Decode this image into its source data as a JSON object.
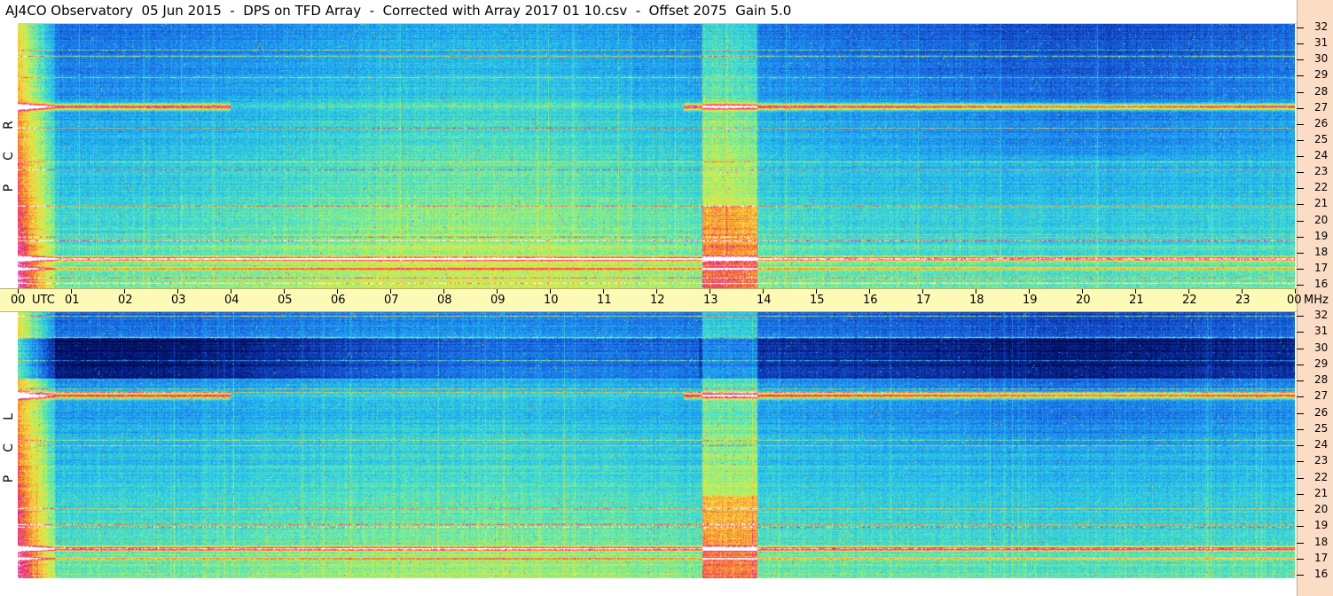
{
  "title": "AJ4CO Observatory  05 Jun 2015  -  DPS on TFD Array  -  Corrected with Array 2017 01 10.csv  -  Offset 2075  Gain 5.0",
  "chart_data": {
    "type": "heatmap",
    "title": "AJ4CO Observatory  05 Jun 2015  -  DPS on TFD Array  -  Corrected with Array 2017 01 10.csv  -  Offset 2075  Gain 5.0",
    "x_axis": {
      "unit_label": "UTC",
      "tick_labels": [
        "00",
        "01",
        "02",
        "03",
        "04",
        "05",
        "06",
        "07",
        "08",
        "09",
        "10",
        "11",
        "12",
        "13",
        "14",
        "15",
        "16",
        "17",
        "18",
        "19",
        "20",
        "21",
        "22",
        "23",
        "00"
      ],
      "range_hours": [
        0,
        24
      ]
    },
    "y_axis": {
      "unit_label": "MHz",
      "tick_labels": [
        "32",
        "31",
        "30",
        "29",
        "28",
        "27",
        "26",
        "25",
        "24",
        "23",
        "22",
        "21",
        "20",
        "19",
        "18",
        "17",
        "16"
      ],
      "range_mhz": [
        16,
        32
      ]
    },
    "panels": [
      {
        "name": "RCP",
        "letters": [
          "R",
          "C",
          "P"
        ]
      },
      {
        "name": "LCP",
        "letters": [
          "L",
          "C",
          "P"
        ]
      }
    ],
    "colormap": [
      "#000a50",
      "#0a2a9a",
      "#1858d8",
      "#1e90f0",
      "#28c8e8",
      "#60e8b0",
      "#c8f050",
      "#f8d840",
      "#f87830",
      "#e01890",
      "#ffffff"
    ],
    "features": {
      "strong_bands_mhz": [
        27,
        17.8
      ],
      "noise_block_utc": [
        12.85,
        13.9
      ]
    }
  }
}
